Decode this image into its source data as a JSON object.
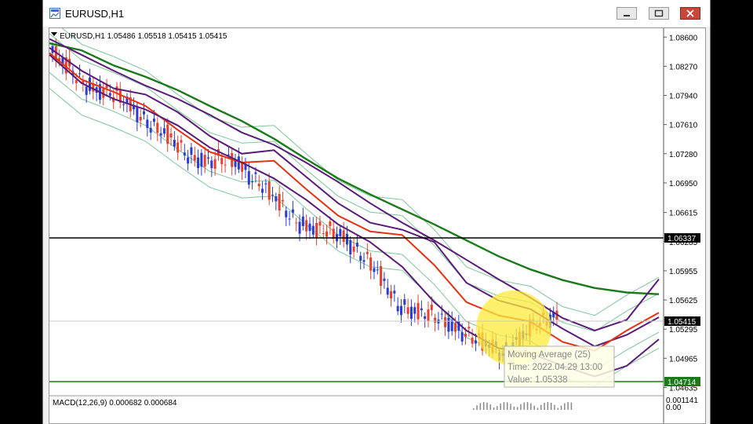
{
  "window": {
    "title": "EURUSD,H1"
  },
  "chart": {
    "header": "EURUSD,H1  1.05486 1.05518 1.05415 1.05415",
    "price_ticks": [
      "1.08600",
      "1.08270",
      "1.07940",
      "1.07610",
      "1.07280",
      "1.06950",
      "1.06615",
      "1.06285",
      "1.05955",
      "1.05625",
      "1.05295",
      "1.04965",
      "1.04635"
    ],
    "level_labels": {
      "horizontal_line": "1.06337",
      "current_price": "1.05415",
      "low_line": "1.04714"
    },
    "tooltip": {
      "name": "Moving Average (25)",
      "time": "Time: 2022.04.29 13:00",
      "value": "Value: 1.05338"
    },
    "macd": {
      "header": "MACD(12,26,9) 0.000682 0.000684",
      "ticks": [
        "0.001141",
        "0.00"
      ]
    },
    "colors": {
      "bull": "#2a3bd6",
      "bear": "#e8402a",
      "ma_green": "#1a7a1a",
      "ma_red": "#e83010",
      "ma_purple": "#5a1a7a",
      "ma_blue": "#2a2ac8",
      "bands": "#7cc79a",
      "highlight": "#ffeb3b"
    }
  },
  "chart_data": {
    "type": "line",
    "title": "EURUSD,H1",
    "xlabel": "",
    "ylabel": "",
    "ylim": [
      1.0455,
      1.087
    ],
    "grid": false,
    "series": [
      {
        "values": [
          1.0853,
          1.0845,
          1.0828,
          1.0815,
          1.08,
          1.0782,
          1.0765,
          1.0745,
          1.0722,
          1.07,
          1.0682,
          1.0665,
          1.0648,
          1.063,
          1.0612,
          1.0597,
          1.0585,
          1.0576,
          1.0571,
          1.0569
        ]
      },
      {
        "values": [
          1.0848,
          1.0822,
          1.0802,
          1.0795,
          1.0775,
          1.0748,
          1.0728,
          1.0732,
          1.0702,
          1.0672,
          1.065,
          1.0642,
          1.0628,
          1.0582,
          1.0562,
          1.0552,
          1.053,
          1.051,
          1.0523,
          1.0543
        ]
      },
      {
        "values": [
          1.0842,
          1.0812,
          1.0798,
          1.0782,
          1.0755,
          1.073,
          1.0718,
          1.072,
          1.0688,
          1.0658,
          1.064,
          1.0636,
          1.0602,
          1.056,
          1.0545,
          1.0538,
          1.0515,
          1.0505,
          1.0528,
          1.0548
        ]
      },
      {
        "values": [
          1.0858,
          1.084,
          1.0822,
          1.0805,
          1.079,
          1.0772,
          1.0752,
          1.0738,
          1.0718,
          1.0696,
          1.0672,
          1.065,
          1.063,
          1.0608,
          1.0586,
          1.0565,
          1.0542,
          1.0528,
          1.054,
          1.0586
        ]
      },
      {
        "values": [
          1.084,
          1.0808,
          1.079,
          1.0778,
          1.076,
          1.0735,
          1.0718,
          1.07,
          1.0676,
          1.0648,
          1.0628,
          1.06,
          1.056,
          1.0528,
          1.0508,
          1.0502,
          1.0488,
          1.0476,
          1.0488,
          1.0518
        ]
      }
    ]
  }
}
